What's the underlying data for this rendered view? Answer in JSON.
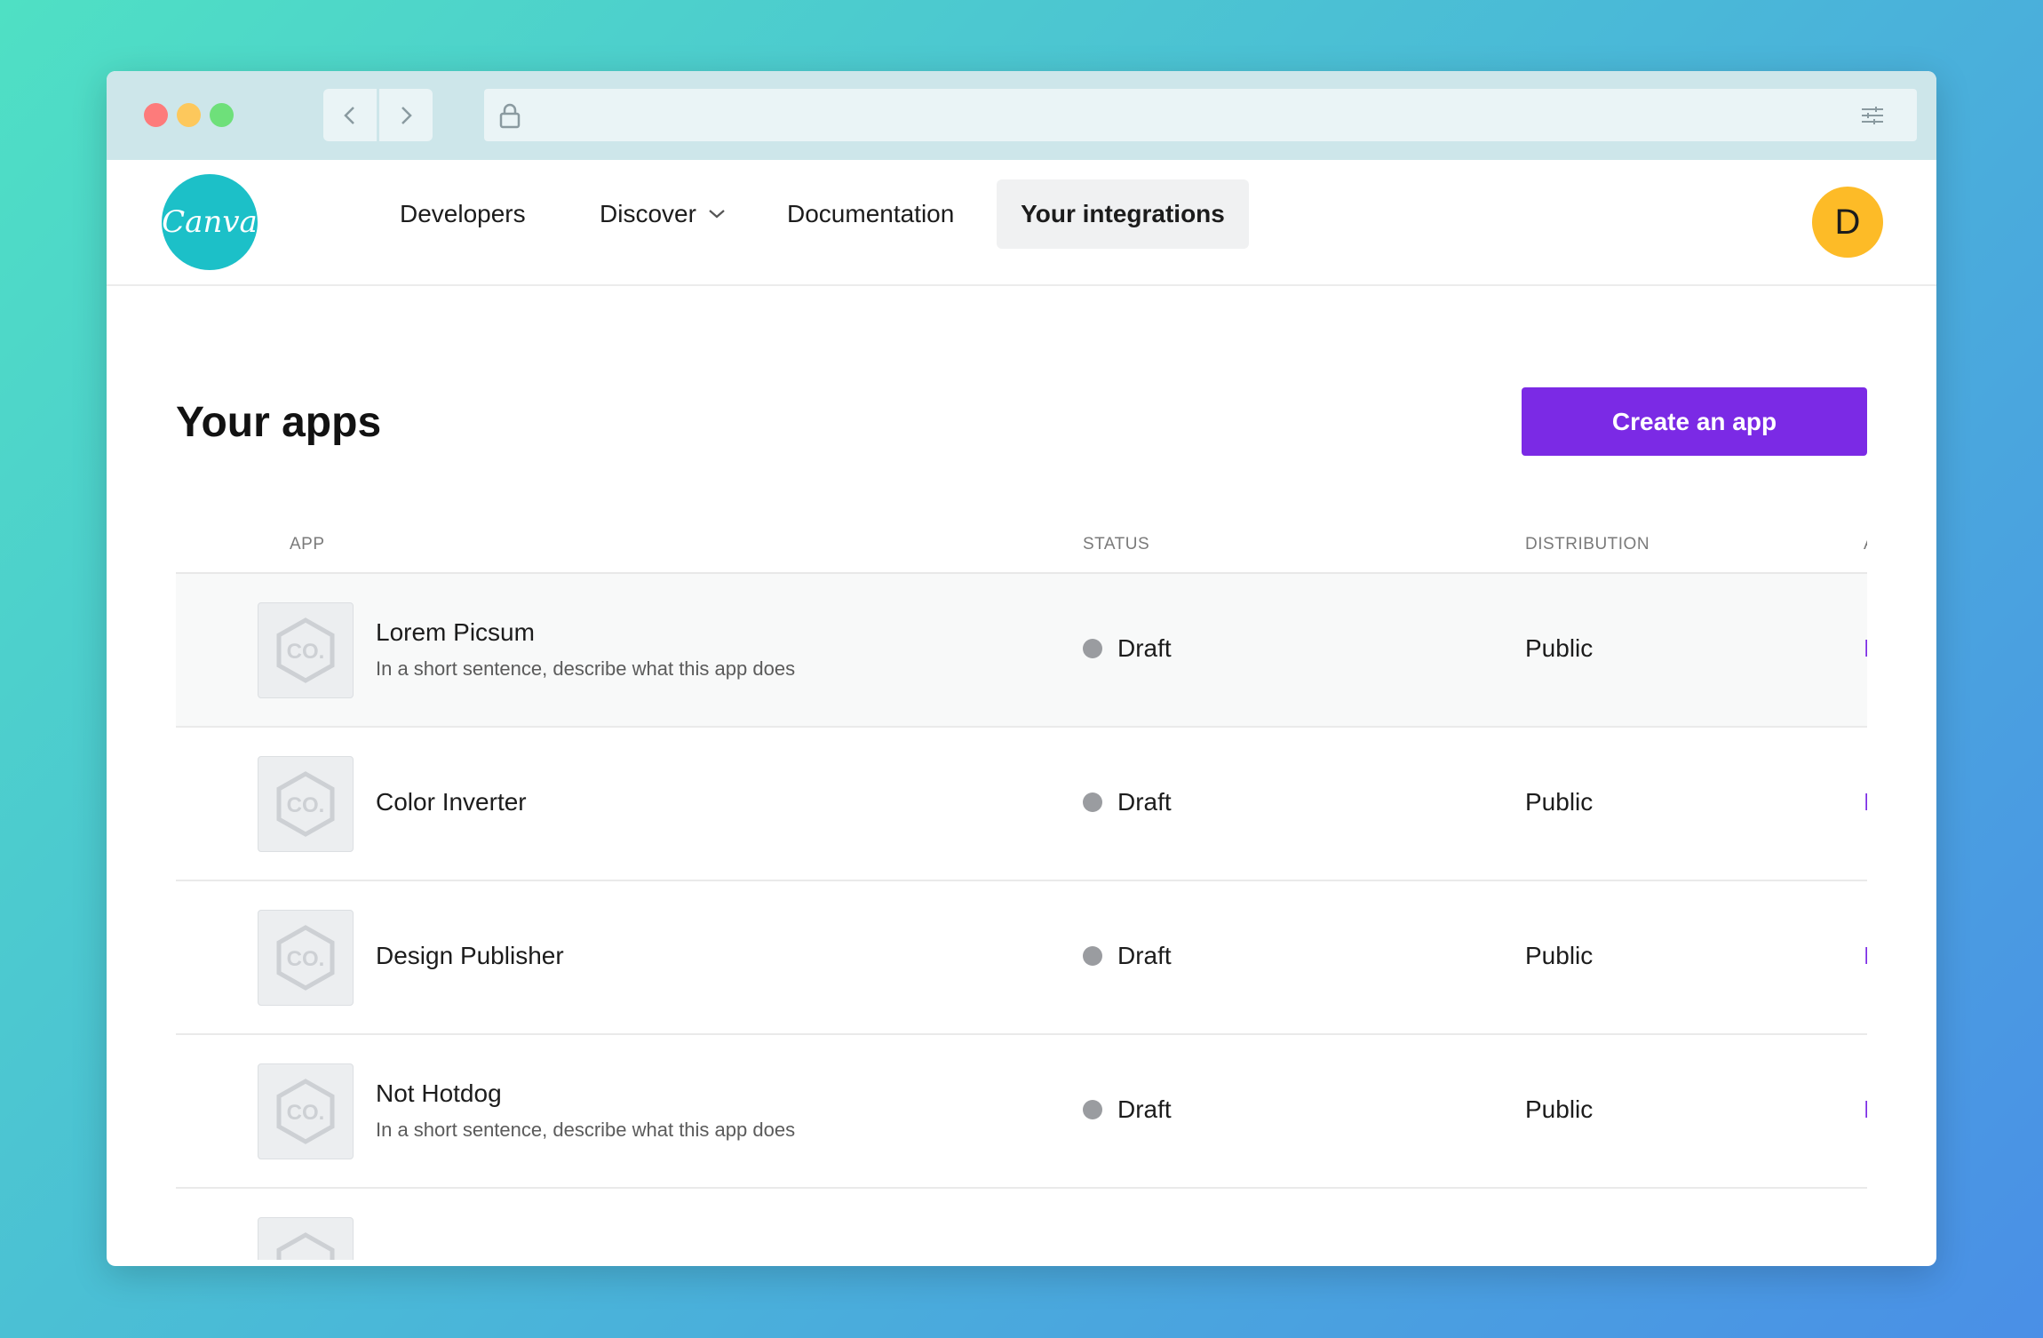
{
  "browser": {
    "icons": {
      "back": "chevron-left-icon",
      "forward": "chevron-right-icon",
      "lock": "lock-icon",
      "settings": "sliders-icon"
    }
  },
  "header": {
    "logo_text": "Canva",
    "nav": [
      {
        "label": "Developers"
      },
      {
        "label": "Discover",
        "has_dropdown": true
      },
      {
        "label": "Documentation"
      },
      {
        "label": "Your integrations",
        "active": true
      }
    ],
    "avatar_initial": "D"
  },
  "main": {
    "title": "Your apps",
    "create_button": "Create an app",
    "table": {
      "columns": [
        "APP",
        "STATUS",
        "DISTRIBUTION",
        "A"
      ],
      "rows": [
        {
          "name": "Lorem Picsum",
          "description": "In a short sentence, describe what this app does",
          "status": "Draft",
          "distribution": "Public",
          "action": "E"
        },
        {
          "name": "Color Inverter",
          "description": "",
          "status": "Draft",
          "distribution": "Public",
          "action": "E"
        },
        {
          "name": "Design Publisher",
          "description": "",
          "status": "Draft",
          "distribution": "Public",
          "action": "E"
        },
        {
          "name": "Not Hotdog",
          "description": "In a short sentence, describe what this app does",
          "status": "Draft",
          "distribution": "Public",
          "action": "E"
        }
      ],
      "thumbnail_text": "CO."
    }
  },
  "colors": {
    "accent": "#7b2ae5",
    "logo": "#1cc0c8",
    "avatar": "#fdbb27",
    "status_dot": "#9a9ca0"
  }
}
